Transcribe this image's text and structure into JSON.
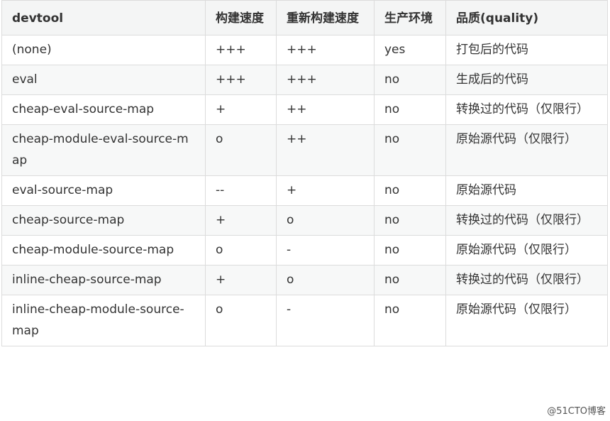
{
  "table": {
    "headers": [
      "devtool",
      "构建速度",
      "重新构建速度",
      "生产环境",
      "品质(quality)"
    ],
    "rows": [
      [
        "(none)",
        "+++",
        "+++",
        "yes",
        "打包后的代码"
      ],
      [
        "eval",
        "+++",
        "+++",
        "no",
        "生成后的代码"
      ],
      [
        "cheap-eval-source-map",
        "+",
        "++",
        "no",
        "转换过的代码（仅限行）"
      ],
      [
        "cheap-module-eval-source-map",
        "o",
        "++",
        "no",
        "原始源代码（仅限行）"
      ],
      [
        "eval-source-map",
        "--",
        "+",
        "no",
        "原始源代码"
      ],
      [
        "cheap-source-map",
        "+",
        "o",
        "no",
        "转换过的代码（仅限行）"
      ],
      [
        "cheap-module-source-map",
        "o",
        "-",
        "no",
        "原始源代码（仅限行）"
      ],
      [
        "inline-cheap-source-map",
        "+",
        "o",
        "no",
        "转换过的代码（仅限行）"
      ],
      [
        "inline-cheap-module-source-map",
        "o",
        "-",
        "no",
        "原始源代码（仅限行）"
      ]
    ]
  },
  "watermark": "@51CTO博客"
}
